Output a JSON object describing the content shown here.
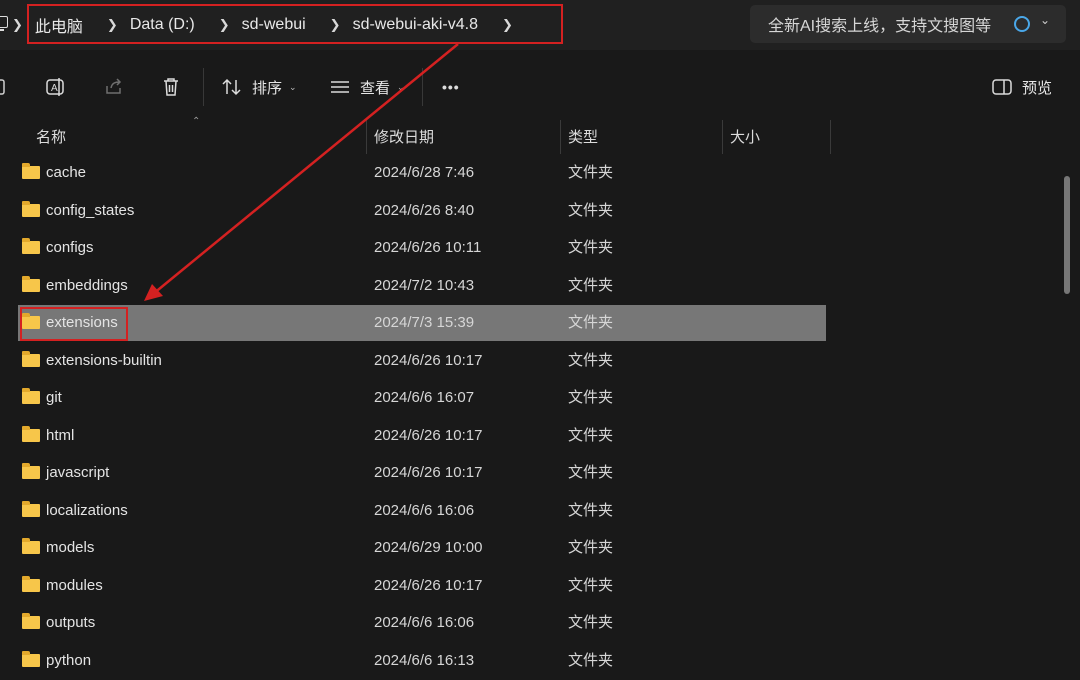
{
  "breadcrumb": {
    "items": [
      "此电脑",
      "Data (D:)",
      "sd-webui",
      "sd-webui-aki-v4.8"
    ]
  },
  "search": {
    "text": "全新AI搜索上线，支持文搜图等"
  },
  "toolbar": {
    "sort_label": "排序",
    "view_label": "查看",
    "more_label": "•••",
    "preview_label": "预览"
  },
  "columns": {
    "name": "名称",
    "date": "修改日期",
    "type": "类型",
    "size": "大小"
  },
  "files": [
    {
      "name": "cache",
      "date": "2024/6/28 7:46",
      "type": "文件夹"
    },
    {
      "name": "config_states",
      "date": "2024/6/26 8:40",
      "type": "文件夹"
    },
    {
      "name": "configs",
      "date": "2024/6/26 10:11",
      "type": "文件夹"
    },
    {
      "name": "embeddings",
      "date": "2024/7/2 10:43",
      "type": "文件夹"
    },
    {
      "name": "extensions",
      "date": "2024/7/3 15:39",
      "type": "文件夹",
      "selected": true
    },
    {
      "name": "extensions-builtin",
      "date": "2024/6/26 10:17",
      "type": "文件夹"
    },
    {
      "name": "git",
      "date": "2024/6/6 16:07",
      "type": "文件夹"
    },
    {
      "name": "html",
      "date": "2024/6/26 10:17",
      "type": "文件夹"
    },
    {
      "name": "javascript",
      "date": "2024/6/26 10:17",
      "type": "文件夹"
    },
    {
      "name": "localizations",
      "date": "2024/6/6 16:06",
      "type": "文件夹"
    },
    {
      "name": "models",
      "date": "2024/6/29 10:00",
      "type": "文件夹"
    },
    {
      "name": "modules",
      "date": "2024/6/26 10:17",
      "type": "文件夹"
    },
    {
      "name": "outputs",
      "date": "2024/6/6 16:06",
      "type": "文件夹"
    },
    {
      "name": "python",
      "date": "2024/6/6 16:13",
      "type": "文件夹"
    }
  ],
  "icons": {
    "crumb_separator": "chevron-right-icon",
    "sort": "sort-icon",
    "view": "view-icon",
    "delete": "trash-icon",
    "share": "share-icon",
    "rename": "rename-icon",
    "preview": "preview-pane-icon",
    "folder": "folder-icon"
  },
  "colors": {
    "annotation": "#d42121",
    "folder": "#f7c64a",
    "selected_row": "#777777",
    "background": "#191919"
  }
}
